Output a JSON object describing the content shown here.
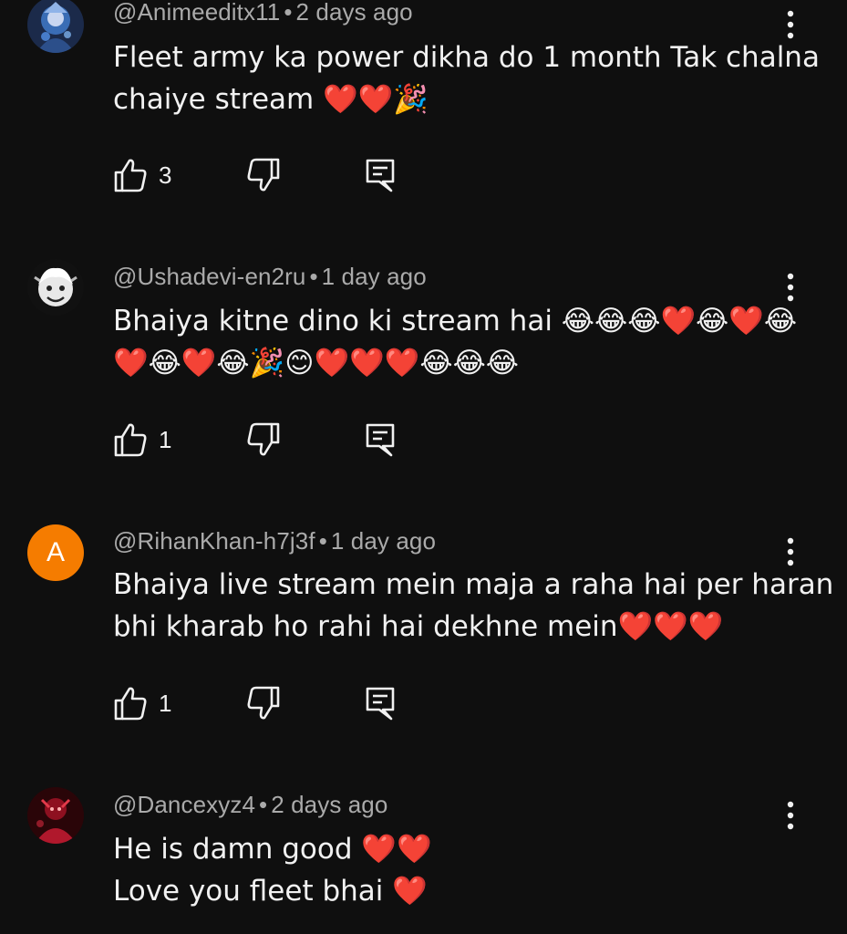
{
  "comments": [
    {
      "username": "@Animeeditx11",
      "separator": "•",
      "time": "2 days ago",
      "lines": [
        "Fleet army ka power dikha do 1 month Tak chalna",
        "chaiye stream ❤️❤️🎉"
      ],
      "likes": "3",
      "avatar_icon": "anime-avatar"
    },
    {
      "username": "@Ushadevi-en2ru",
      "separator": "•",
      "time": "1 day ago",
      "lines": [
        "Bhaiya kitne dino ki stream hai  😂😂😂❤️😂❤️😂",
        "❤️😂❤️😂🎉😊❤️❤️❤️😂😂😂"
      ],
      "likes": "1",
      "avatar_icon": "luffy-avatar"
    },
    {
      "username": "@RihanKhan-h7j3f",
      "separator": "•",
      "time": "1 day ago",
      "lines": [
        "Bhaiya live stream mein maja a raha hai per haran",
        "bhi kharab ho rahi hai dekhne mein❤️❤️❤️"
      ],
      "likes": "1",
      "avatar_letter": "A",
      "avatar_color": "#f57c00"
    },
    {
      "username": "@Dancexyz4",
      "separator": "•",
      "time": "2 days ago",
      "lines": [
        "He is damn good ❤️❤️",
        "Love you fleet bhai ❤️"
      ],
      "avatar_icon": "red-figure-avatar"
    }
  ],
  "colors": {
    "background": "#0f0f0f",
    "text": "#f1f1f1",
    "meta": "#aaaaaa",
    "heart": "#ff3b6b"
  }
}
